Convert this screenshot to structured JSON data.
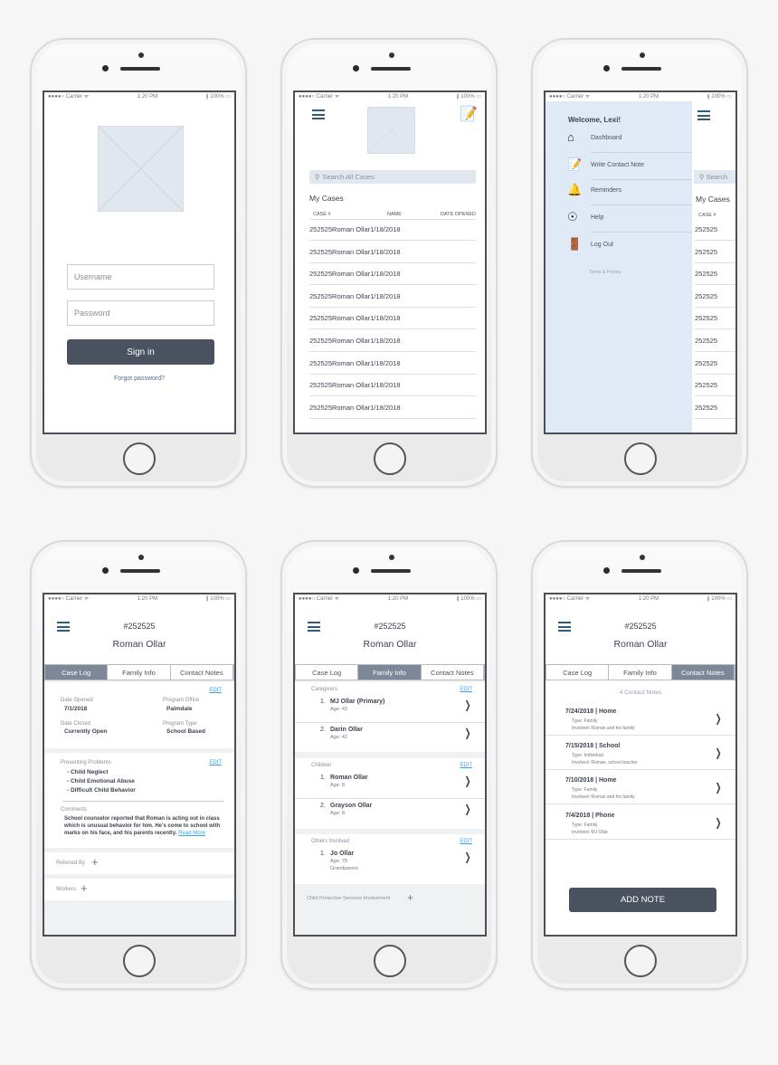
{
  "status_bar": {
    "carrier": "●●●●○ Carrier ᯤ",
    "time": "1:20 PM",
    "battery": "∦ 100% ▭"
  },
  "login": {
    "username_placeholder": "Username",
    "password_placeholder": "Password",
    "sign_in": "Sign in",
    "forgot": "Forgot password?"
  },
  "cases": {
    "search_placeholder": "Search All Cases",
    "title": "My Cases",
    "headers": [
      "CASE #",
      "NAME",
      "DATE OPENED"
    ],
    "rows": [
      [
        "252525",
        "Roman Ollar",
        "1/18/2018"
      ],
      [
        "252525",
        "Roman Ollar",
        "1/18/2018"
      ],
      [
        "252525",
        "Roman Ollar",
        "1/18/2018"
      ],
      [
        "252525",
        "Roman Ollar",
        "1/18/2018"
      ],
      [
        "252525",
        "Roman Ollar",
        "1/18/2018"
      ],
      [
        "252525",
        "Roman Ollar",
        "1/18/2018"
      ],
      [
        "252525",
        "Roman Ollar",
        "1/18/2018"
      ],
      [
        "252525",
        "Roman Ollar",
        "1/18/2018"
      ],
      [
        "252525",
        "Roman Ollar",
        "1/18/2018"
      ]
    ]
  },
  "menu": {
    "welcome": "Welcome, Lexi!",
    "items": [
      {
        "label": "Dashboard",
        "icon": "home-icon"
      },
      {
        "label": "Write Contact Note",
        "icon": "note-icon"
      },
      {
        "label": "Reminders",
        "icon": "bell-icon"
      },
      {
        "label": "Help",
        "icon": "lifebuoy-icon"
      },
      {
        "label": "Log Out",
        "icon": "logout-icon"
      }
    ],
    "terms": "Terms & Privacy",
    "search_partial": "Search"
  },
  "case": {
    "number": "#252525",
    "name": "Roman Ollar",
    "tabs": [
      "Case Log",
      "Family Info",
      "Contact Notes"
    ],
    "edit": "EDIT"
  },
  "case_log": {
    "date_opened_label": "Date Opened",
    "date_opened": "7/1/2018",
    "program_office_label": "Program Office",
    "program_office": "Palmdale",
    "date_closed_label": "Date Closed",
    "date_closed": "Currently Open",
    "program_type_label": "Program Type",
    "program_type": "School Based",
    "problems_label": "Presenting Problems",
    "problems": [
      "- Child Neglect",
      "- Child Emotional Abuse",
      "- Difficult Child Behavior"
    ],
    "comments_label": "Comments",
    "comments": "School counselor reported that Roman is acting out in class which is unusual behavior for him. He's come to school with marks on his face, and his parents recently.",
    "read_more": "Read More",
    "referred_by": "Referred By",
    "workers": "Workers"
  },
  "family": {
    "caregivers_label": "Caregivers",
    "caregivers": [
      {
        "n": "1.",
        "name": "MJ Ollar (Primary)",
        "age": "Age: 43"
      },
      {
        "n": "2.",
        "name": "Darin Ollar",
        "age": "Age: 42"
      }
    ],
    "children_label": "Children",
    "children": [
      {
        "n": "1.",
        "name": "Roman Ollar",
        "age": "Age: 8"
      },
      {
        "n": "2.",
        "name": "Grayson Ollar",
        "age": "Age: 8"
      }
    ],
    "others_label": "Others Involved",
    "others": [
      {
        "n": "1.",
        "name": "Jo Ollar",
        "age": "Age: 78",
        "rel": "Grandparent"
      }
    ],
    "cps": "Child Protective Services Involvement"
  },
  "notes": {
    "count": "4 Contact Notes",
    "items": [
      {
        "title": "7/24/2018 | Home",
        "type": "Type: Family",
        "involved": "Involved: Roman and his family"
      },
      {
        "title": "7/15/2018 | School",
        "type": "Type: Individual",
        "involved": "Involved: Roman, school teacher"
      },
      {
        "title": "7/10/2018 | Home",
        "type": "Type: Family",
        "involved": "Involved: Roman and his family"
      },
      {
        "title": "7/4/2018 | Phone",
        "type": "Type: Family",
        "involved": "Involved: MJ Ollar"
      }
    ],
    "add": "ADD NOTE"
  },
  "colors": {
    "accent": "#2f5a78",
    "button": "#4a5260",
    "menu_bg": "#e0eaf6",
    "link": "#3aa0e8"
  }
}
